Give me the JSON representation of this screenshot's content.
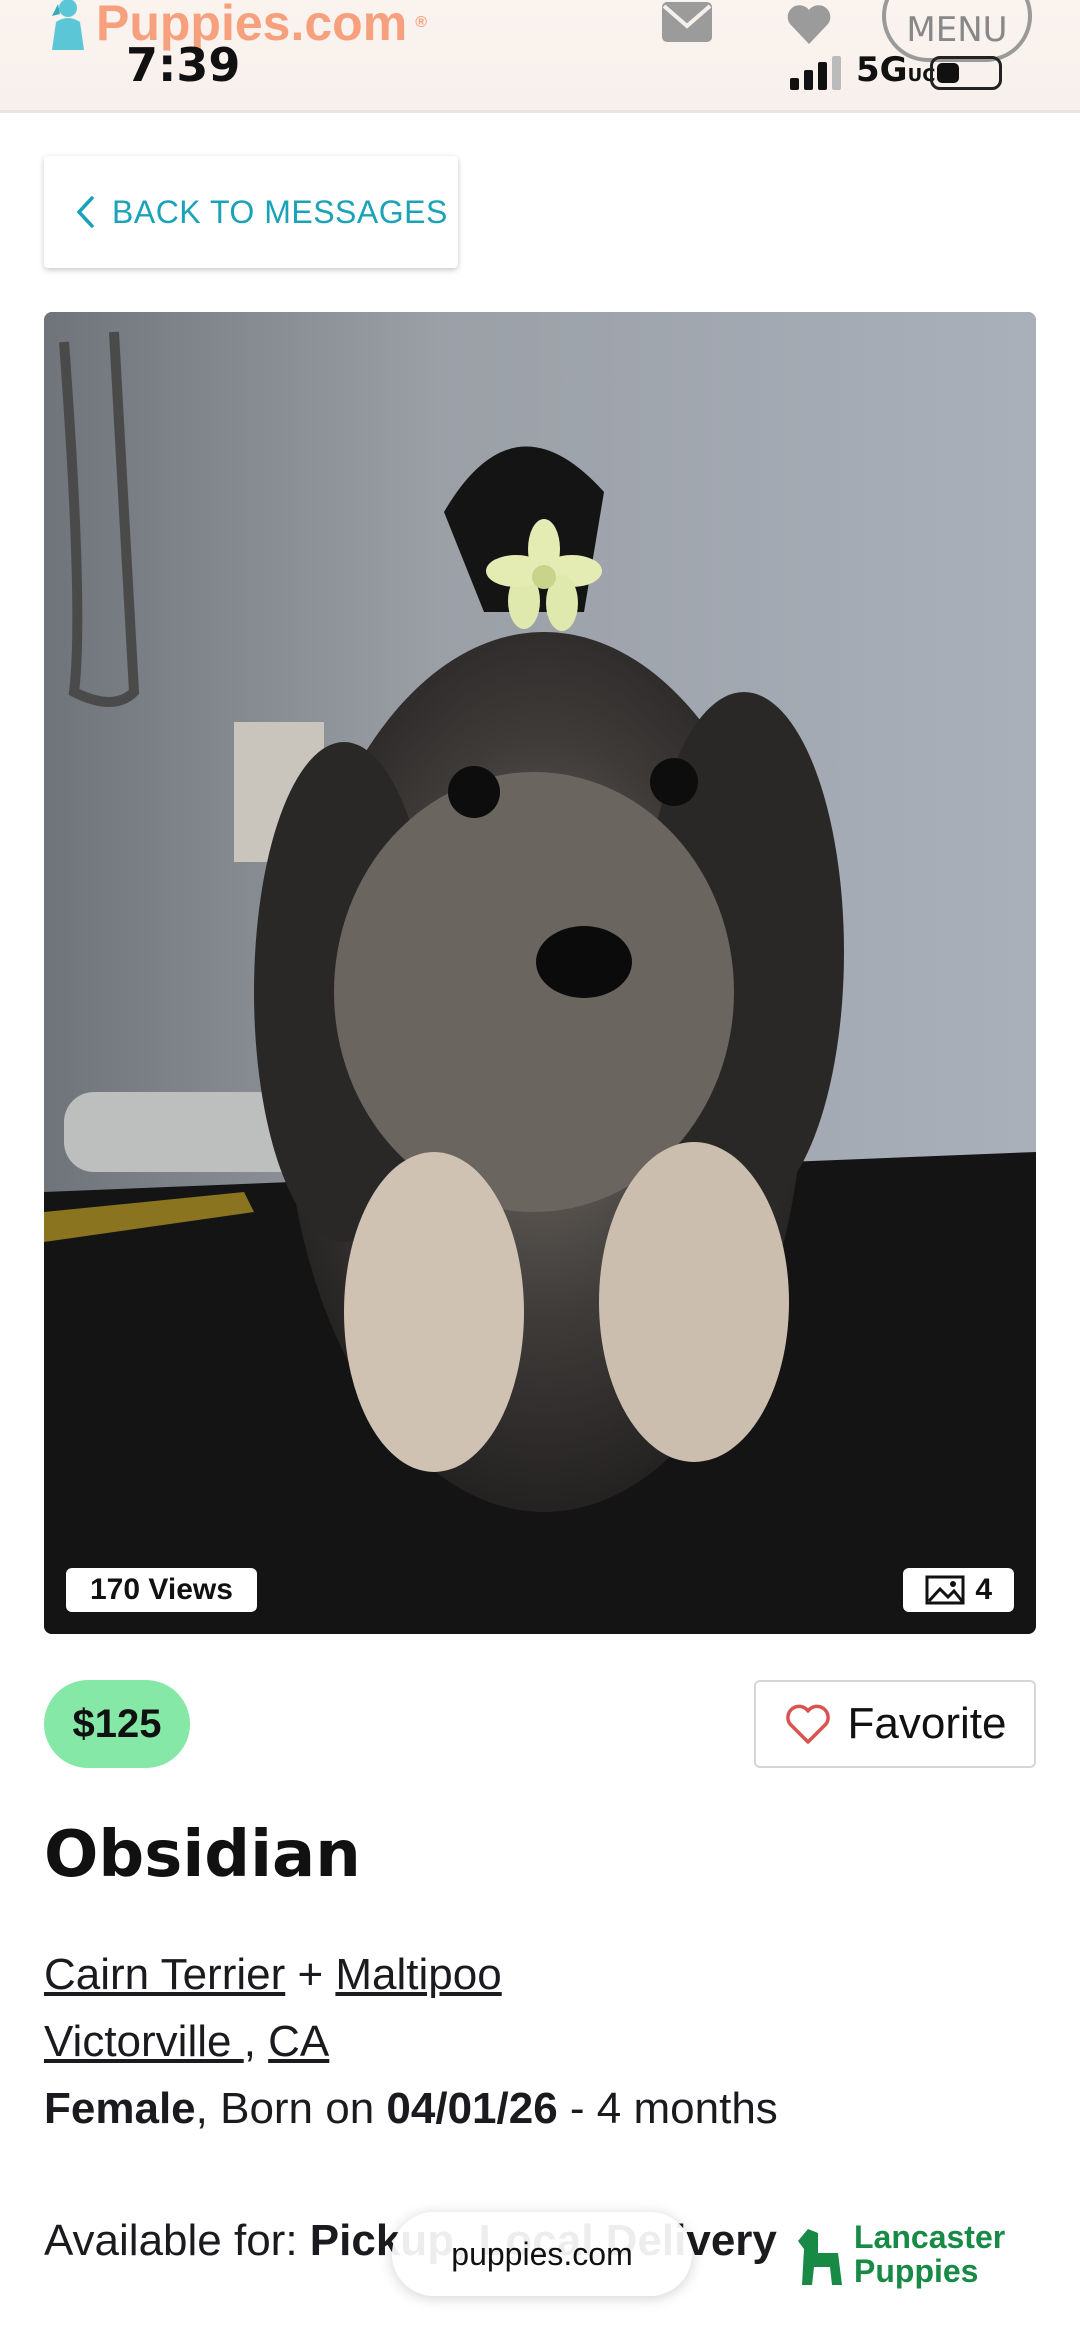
{
  "status_bar": {
    "time": "7:39",
    "network": "5G",
    "network_suffix": "UC"
  },
  "header": {
    "brand": "Puppies.com",
    "brand_mark": "®",
    "menu_label": "MENU",
    "icons": [
      "mail-icon",
      "heart-icon"
    ]
  },
  "back_button": {
    "label": "BACK TO MESSAGES"
  },
  "listing": {
    "views_label": "170 Views",
    "photo_count": "4",
    "price": "$125",
    "favorite_label": "Favorite",
    "name": "Obsidian",
    "breed_1": "Cairn Terrier",
    "breed_joiner": " + ",
    "breed_2": "Maltipoo",
    "city": "Victorville ",
    "location_sep": ", ",
    "state": "CA",
    "sex": "Female",
    "born_prefix": ", Born on ",
    "born_date": "04/01/26",
    "age": " - 4 months",
    "available_label": "Available for: ",
    "available_value": "Pickup, Local Delivery"
  },
  "sponsor": {
    "line1": "Lancaster",
    "line2": "Puppies"
  },
  "url_bar": {
    "domain": "puppies.com"
  },
  "colors": {
    "accent_teal": "#1aa3b8",
    "brand_orange": "#f6a07e",
    "price_green": "#86e8a6",
    "heart_red": "#d9534f",
    "lancaster_green": "#178a45"
  }
}
